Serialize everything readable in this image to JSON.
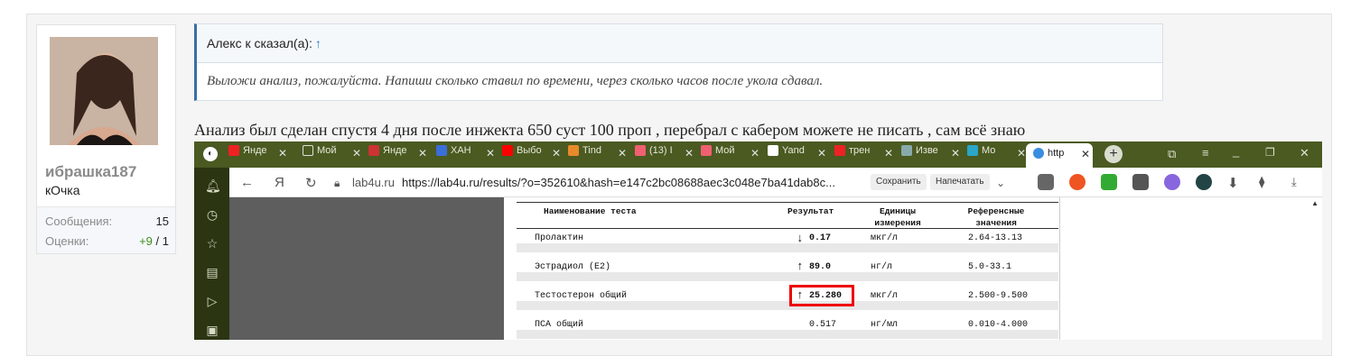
{
  "user": {
    "name": "ибрашка187",
    "title": "кОчка",
    "stats": [
      {
        "label": "Сообщения:",
        "value": "15"
      },
      {
        "label": "Оценки:",
        "value_pos": "+9",
        "value_sep": " / ",
        "value_total": "1"
      }
    ]
  },
  "quote": {
    "author": "Алекс к сказал(а):",
    "arrow": "↑",
    "text": "Выложи анализ, пожалуйста. Напиши сколько ставил по времени, через сколько часов после укола сдавал."
  },
  "post_text": "Анализ был сделан спустя 4 дня после инжекта 650 суст 100 проп , перебрал с кабером можете не писать , сам всё знаю",
  "browser": {
    "tabs": [
      "Янде",
      "Мой",
      "Янде",
      "ХАН",
      "Выбо",
      "Tind",
      "(13) I",
      "Мой",
      "Yand",
      "трен",
      "Изве",
      "Мо",
      "http"
    ],
    "url_domain": "lab4u.ru",
    "url": "https://lab4u.ru/results/?o=352610&hash=e147c2bc08688aec3c048e7ba41dab8c...",
    "save_label": "Сохранить",
    "print_label": "Напечатать",
    "colors": {
      "tabbar": "#4a5a21",
      "sidebar": "#2b3512"
    }
  },
  "lab": {
    "headers": {
      "name": "Наименование теста",
      "result": "Результат",
      "units": "Единицы измерения",
      "ref": "Референсные значения"
    },
    "rows": [
      {
        "arrow": "↓",
        "name": "Пролактин",
        "result": "0.17",
        "units": "мкг/л",
        "ref": "2.64-13.13"
      },
      {
        "arrow": "↑",
        "name": "Эстрадиол (E2)",
        "result": "89.0",
        "units": "нг/л",
        "ref": "5.0-33.1"
      },
      {
        "arrow": "↑",
        "name": "Тестостерон общий",
        "result": "25.280",
        "units": "мкг/л",
        "ref": "2.500-9.500"
      },
      {
        "arrow": "",
        "name": "ПСА общий",
        "result": "0.517",
        "units": "нг/мл",
        "ref": "0.010-4.000"
      }
    ]
  }
}
